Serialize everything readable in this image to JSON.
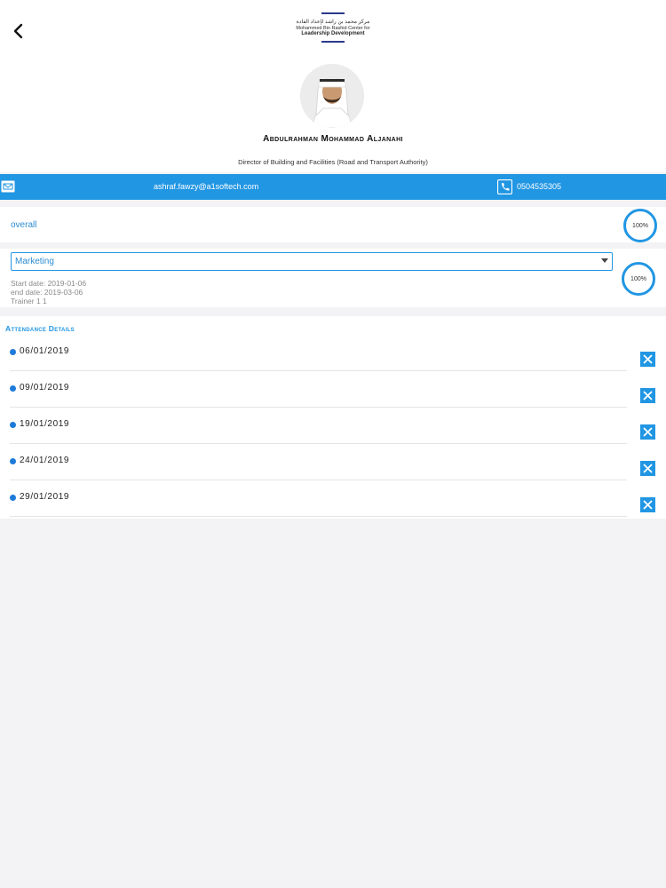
{
  "header": {
    "logo_arabic": "مركز محمد بن راشد لإعداد القادة",
    "logo_english_line1": "Mohammed Bin Rashid Center for",
    "logo_english_line2": "Leadership Development"
  },
  "profile": {
    "name": "Abdulrahman Mohammad Aljanahi",
    "title": "Director of Building and Facilities (Road and Transport Authority)"
  },
  "contact": {
    "email": "ashraf.fawzy@a1softech.com",
    "phone": "0504535305"
  },
  "overall": {
    "label": "overall",
    "percent": "100%"
  },
  "course": {
    "selected": "Marketing",
    "start_date": "Start date: 2019-01-06",
    "end_date": "end date: 2019-03-06",
    "trainer": "Trainer 1 1",
    "percent": "100%"
  },
  "attendance": {
    "title": "Attendance Details",
    "rows": [
      "06/01/2019",
      "09/01/2019",
      "19/01/2019",
      "24/01/2019",
      "29/01/2019"
    ]
  },
  "colors": {
    "accent": "#2196e3",
    "link": "#2a8bd1",
    "background": "#f3f3f5"
  },
  "icons": [
    "back-arrow-icon",
    "mail-icon",
    "phone-icon",
    "chevron-down-icon",
    "close-icon"
  ]
}
